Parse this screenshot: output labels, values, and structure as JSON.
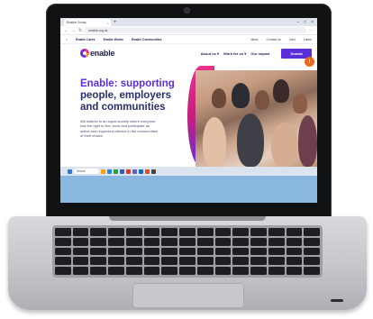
{
  "browser": {
    "tab_title": "Enable Group",
    "tab_close": "×",
    "new_tab": "+",
    "url": "enable.org.uk",
    "window_controls": [
      "–",
      "□",
      "×"
    ]
  },
  "site": {
    "top_links": [
      "Enable Cares",
      "Enable Works",
      "Enable Communities"
    ],
    "utility_links": [
      "News",
      "Contact us",
      "Jobs",
      "Listen"
    ],
    "logo_text": "enable",
    "nav": [
      "About us ▾",
      "Work for us ▾",
      "Our impact"
    ],
    "donate_label": "Donate",
    "hero_title_a": "Enable: supporting",
    "hero_title_b": "people, employers and communities",
    "hero_body": "We believe in an equal society where everyone has the right to live, work and participate as active and respected citizens in the communities of their choice.",
    "chat_icon": "!"
  },
  "taskbar": {
    "search_label": "Search",
    "time": "",
    "date": ""
  },
  "colors": {
    "brand_purple": "#5b2fd6",
    "brand_pink": "#e9338a",
    "navy": "#1c2150",
    "desktop_blue": "#8ab7e0"
  }
}
